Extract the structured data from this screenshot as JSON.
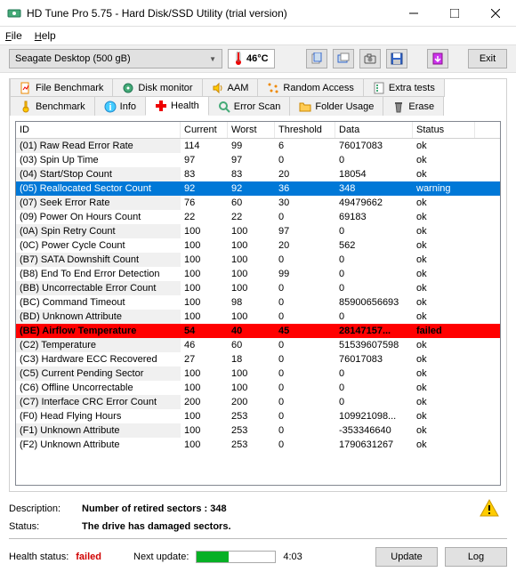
{
  "window": {
    "title": "HD Tune Pro 5.75 - Hard Disk/SSD Utility (trial version)"
  },
  "menu": {
    "file": "File",
    "help": "Help"
  },
  "toolbar": {
    "drive": "Seagate Desktop (500 gB)",
    "temperature": "46°C",
    "exit": "Exit"
  },
  "tabs": {
    "file_benchmark": "File Benchmark",
    "disk_monitor": "Disk monitor",
    "aam": "AAM",
    "random_access": "Random Access",
    "extra_tests": "Extra tests",
    "benchmark": "Benchmark",
    "info": "Info",
    "health": "Health",
    "error_scan": "Error Scan",
    "folder_usage": "Folder Usage",
    "erase": "Erase"
  },
  "columns": {
    "id": "ID",
    "current": "Current",
    "worst": "Worst",
    "threshold": "Threshold",
    "data": "Data",
    "status": "Status"
  },
  "rows": [
    {
      "id": "(01) Raw Read Error Rate",
      "cur": "114",
      "wor": "99",
      "thr": "6",
      "dat": "76017083",
      "sta": "ok",
      "cls": ""
    },
    {
      "id": "(03) Spin Up Time",
      "cur": "97",
      "wor": "97",
      "thr": "0",
      "dat": "0",
      "sta": "ok",
      "cls": ""
    },
    {
      "id": "(04) Start/Stop Count",
      "cur": "83",
      "wor": "83",
      "thr": "20",
      "dat": "18054",
      "sta": "ok",
      "cls": ""
    },
    {
      "id": "(05) Reallocated Sector Count",
      "cur": "92",
      "wor": "92",
      "thr": "36",
      "dat": "348",
      "sta": "warning",
      "cls": "warning"
    },
    {
      "id": "(07) Seek Error Rate",
      "cur": "76",
      "wor": "60",
      "thr": "30",
      "dat": "49479662",
      "sta": "ok",
      "cls": ""
    },
    {
      "id": "(09) Power On Hours Count",
      "cur": "22",
      "wor": "22",
      "thr": "0",
      "dat": "69183",
      "sta": "ok",
      "cls": ""
    },
    {
      "id": "(0A) Spin Retry Count",
      "cur": "100",
      "wor": "100",
      "thr": "97",
      "dat": "0",
      "sta": "ok",
      "cls": ""
    },
    {
      "id": "(0C) Power Cycle Count",
      "cur": "100",
      "wor": "100",
      "thr": "20",
      "dat": "562",
      "sta": "ok",
      "cls": ""
    },
    {
      "id": "(B7) SATA Downshift Count",
      "cur": "100",
      "wor": "100",
      "thr": "0",
      "dat": "0",
      "sta": "ok",
      "cls": ""
    },
    {
      "id": "(B8) End To End Error Detection",
      "cur": "100",
      "wor": "100",
      "thr": "99",
      "dat": "0",
      "sta": "ok",
      "cls": ""
    },
    {
      "id": "(BB) Uncorrectable Error Count",
      "cur": "100",
      "wor": "100",
      "thr": "0",
      "dat": "0",
      "sta": "ok",
      "cls": ""
    },
    {
      "id": "(BC) Command Timeout",
      "cur": "100",
      "wor": "98",
      "thr": "0",
      "dat": "85900656693",
      "sta": "ok",
      "cls": ""
    },
    {
      "id": "(BD) Unknown Attribute",
      "cur": "100",
      "wor": "100",
      "thr": "0",
      "dat": "0",
      "sta": "ok",
      "cls": ""
    },
    {
      "id": "(BE) Airflow Temperature",
      "cur": "54",
      "wor": "40",
      "thr": "45",
      "dat": "28147157...",
      "sta": "failed",
      "cls": "failed"
    },
    {
      "id": "(C2) Temperature",
      "cur": "46",
      "wor": "60",
      "thr": "0",
      "dat": "51539607598",
      "sta": "ok",
      "cls": ""
    },
    {
      "id": "(C3) Hardware ECC Recovered",
      "cur": "27",
      "wor": "18",
      "thr": "0",
      "dat": "76017083",
      "sta": "ok",
      "cls": ""
    },
    {
      "id": "(C5) Current Pending Sector",
      "cur": "100",
      "wor": "100",
      "thr": "0",
      "dat": "0",
      "sta": "ok",
      "cls": ""
    },
    {
      "id": "(C6) Offline Uncorrectable",
      "cur": "100",
      "wor": "100",
      "thr": "0",
      "dat": "0",
      "sta": "ok",
      "cls": ""
    },
    {
      "id": "(C7) Interface CRC Error Count",
      "cur": "200",
      "wor": "200",
      "thr": "0",
      "dat": "0",
      "sta": "ok",
      "cls": ""
    },
    {
      "id": "(F0) Head Flying Hours",
      "cur": "100",
      "wor": "253",
      "thr": "0",
      "dat": "109921098...",
      "sta": "ok",
      "cls": ""
    },
    {
      "id": "(F1) Unknown Attribute",
      "cur": "100",
      "wor": "253",
      "thr": "0",
      "dat": "-353346640",
      "sta": "ok",
      "cls": ""
    },
    {
      "id": "(F2) Unknown Attribute",
      "cur": "100",
      "wor": "253",
      "thr": "0",
      "dat": "1790631267",
      "sta": "ok",
      "cls": ""
    }
  ],
  "description": {
    "label_desc": "Description:",
    "value_desc": "Number of retired sectors : 348",
    "label_status": "Status:",
    "value_status": "The drive has damaged sectors."
  },
  "footer": {
    "health_label": "Health status:",
    "health_value": "failed",
    "next_update_label": "Next update:",
    "next_update_time": "4:03",
    "update_btn": "Update",
    "log_btn": "Log"
  }
}
